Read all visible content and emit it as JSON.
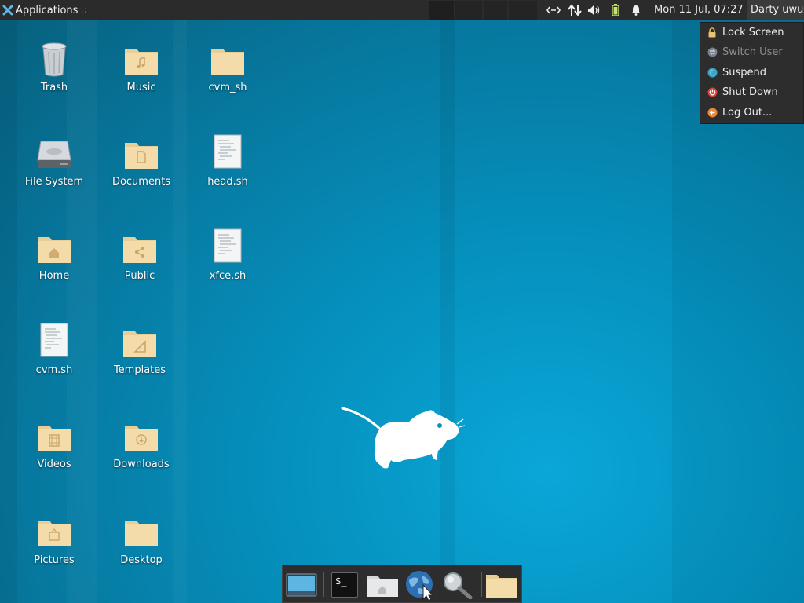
{
  "panel": {
    "apps_label": "Applications",
    "apps_more": "∷",
    "clock": "Mon 11 Jul, 07:27",
    "user": "Darty uwu",
    "tray_icons": [
      "network-arrows-icon",
      "transfer-icon",
      "volume-icon",
      "battery-icon",
      "bell-icon"
    ]
  },
  "action_menu": {
    "items": [
      {
        "label": "Lock Screen",
        "icon": "lock-icon",
        "enabled": true
      },
      {
        "label": "Switch User",
        "icon": "switch-user-icon",
        "enabled": false
      },
      {
        "label": "Suspend",
        "icon": "suspend-icon",
        "enabled": true
      },
      {
        "label": "Shut Down",
        "icon": "power-icon",
        "enabled": true
      },
      {
        "label": "Log Out...",
        "icon": "logout-icon",
        "enabled": true
      }
    ]
  },
  "desktop": {
    "icons": [
      {
        "label": "Trash",
        "type": "trash"
      },
      {
        "label": "Music",
        "type": "folder"
      },
      {
        "label": "cvm_sh",
        "type": "folder"
      },
      {
        "label": "File System",
        "type": "drive"
      },
      {
        "label": "Documents",
        "type": "folder"
      },
      {
        "label": "head.sh",
        "type": "script"
      },
      {
        "label": "Home",
        "type": "folder"
      },
      {
        "label": "Public",
        "type": "folder"
      },
      {
        "label": "xfce.sh",
        "type": "script"
      },
      {
        "label": "cvm.sh",
        "type": "script"
      },
      {
        "label": "Templates",
        "type": "folder"
      },
      {
        "label": "Videos",
        "type": "folder"
      },
      {
        "label": "Downloads",
        "type": "folder"
      },
      {
        "label": "Pictures",
        "type": "folder"
      },
      {
        "label": "Desktop",
        "type": "folder"
      }
    ]
  },
  "dock": {
    "items": [
      "show-desktop-icon",
      "terminal-icon",
      "home-folder-icon",
      "web-browser-icon",
      "search-icon",
      "folder-icon"
    ],
    "terminal_glyph": "$_"
  },
  "colors": {
    "panel": "#2b2b2b",
    "desktop_accent": "#0aa7d8",
    "folder": "#f2d9a8",
    "power_red": "#d9453b",
    "logout_orange": "#e8883a",
    "suspend_blue": "#3ca6c9"
  }
}
